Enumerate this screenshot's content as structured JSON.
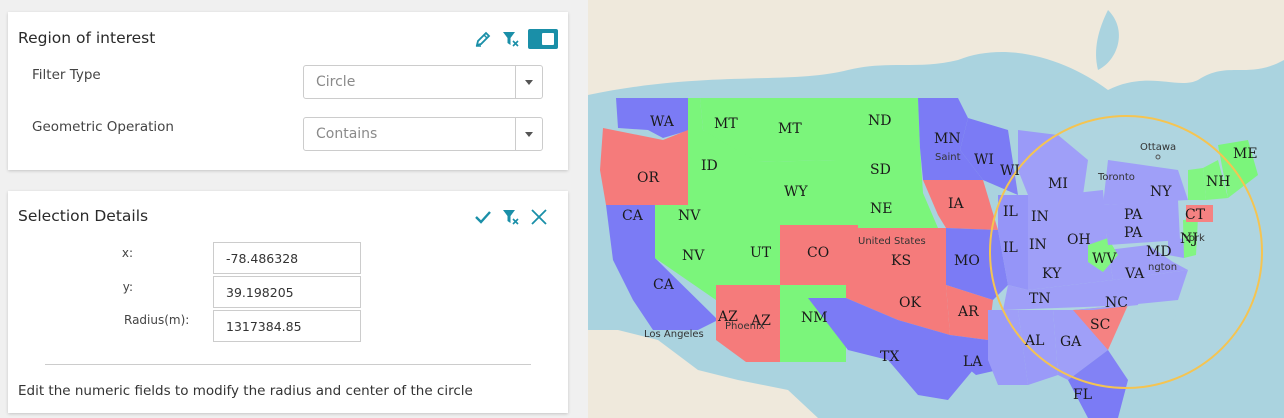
{
  "roi": {
    "title": "Region of interest",
    "filter_type_label": "Filter Type",
    "filter_type_value": "Circle",
    "geometric_operation_label": "Geometric Operation",
    "geometric_operation_value": "Contains"
  },
  "selection": {
    "title": "Selection Details",
    "x_label": "x:",
    "x_value": "-78.486328",
    "y_label": "y:",
    "y_value": "39.198205",
    "radius_label": "Radius(m):",
    "radius_value": "1317384.85",
    "hint": "Edit the numeric fields to modify the radius and center of the circle"
  },
  "map": {
    "colors": {
      "blue": "#7b7bf5",
      "green": "#7bf57b",
      "red": "#f57b7b",
      "selected": "#9a9af8",
      "water": "#aad3df",
      "land": "#efe9dc",
      "circle": "#f5c451"
    },
    "state_labels": [
      "WA",
      "MT",
      "MT",
      "ND",
      "MN",
      "WI",
      "WI",
      "OR",
      "ID",
      "SD",
      "MI",
      "NY",
      "ME",
      "NH",
      "WY",
      "IA",
      "NE",
      "IL",
      "IN",
      "PA",
      "PA",
      "CT",
      "CA",
      "NV",
      "NV",
      "UT",
      "CO",
      "IL",
      "IN",
      "OH",
      "NJ",
      "MD",
      "KS",
      "MO",
      "WV",
      "VA",
      "CA",
      "KY",
      "TN",
      "NC",
      "OK",
      "AR",
      "AZ",
      "AZ",
      "NM",
      "SC",
      "AL",
      "GA",
      "LA",
      "TX",
      "FL"
    ],
    "place_labels": [
      "Ottawa",
      "Toronto",
      "Saint",
      "United States",
      "York",
      "ngton",
      "Los Angeles",
      "Phoenix"
    ]
  }
}
